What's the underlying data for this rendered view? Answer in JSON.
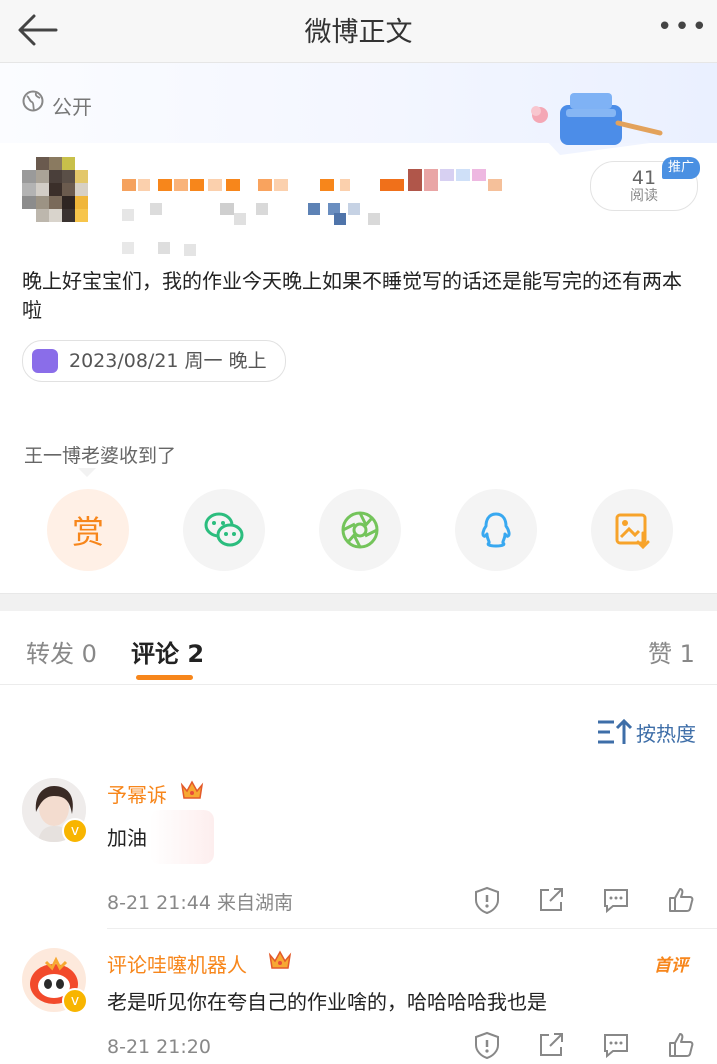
{
  "nav": {
    "title": "微博正文"
  },
  "post": {
    "visibility": "公开",
    "read_count": "41",
    "read_label": "阅读",
    "promo_label": "推广",
    "content": "晚上好宝宝们，我的作业今天晚上如果不睡觉写的话还是能写完的还有两本啦",
    "date_tag": "2023/08/21 周一 晚上",
    "gift_label": "王一博老婆收到了",
    "reward_label": "赏"
  },
  "tabs": [
    {
      "label": "转发",
      "count": "0"
    },
    {
      "label": "评论",
      "count": "2"
    },
    {
      "label": "赞",
      "count": "1"
    }
  ],
  "sort_label": "按热度",
  "comments": [
    {
      "user": "予幂诉",
      "text": "加油",
      "time": "8-21 21:44",
      "location": "来自湖南",
      "tag": ""
    },
    {
      "user": "评论哇噻机器人",
      "text": "老是听见你在夸自己的作业啥的，哈哈哈哈我也是",
      "time": "8-21 21:20",
      "location": "",
      "tag": "首评"
    }
  ],
  "colors": {
    "accent": "#f7861b",
    "link_blue": "#3e6ea8",
    "promo_blue": "#4a90e2"
  }
}
